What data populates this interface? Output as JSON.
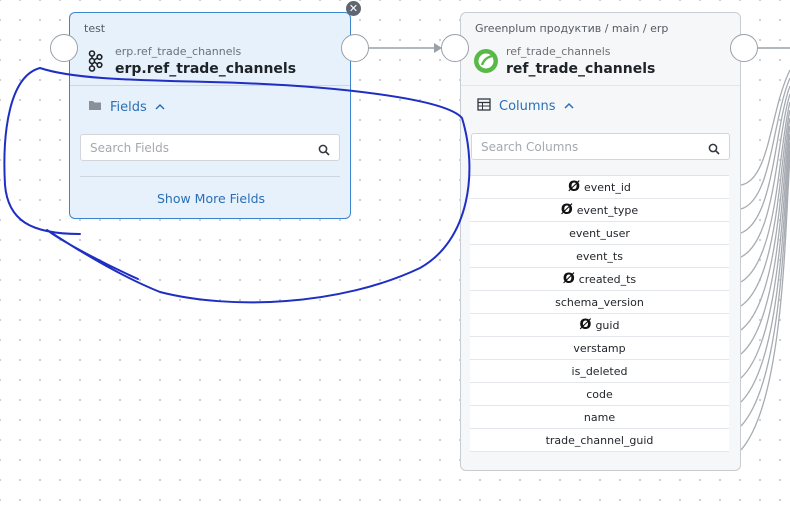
{
  "left_node": {
    "context": "test",
    "subtitle": "erp.ref_trade_channels",
    "title": "erp.ref_trade_channels",
    "fields_label": "Fields",
    "search_placeholder": "Search Fields",
    "show_more": "Show More Fields",
    "icon": "kafka-topic-icon",
    "close_icon": "close-icon"
  },
  "right_node": {
    "breadcrumb": "Greenplum продуктив / main / erp",
    "subtitle": "ref_trade_channels",
    "title": "ref_trade_channels",
    "columns_label": "Columns",
    "search_placeholder": "Search Columns",
    "icon": "greenplum-icon",
    "columns": [
      {
        "name": "event_id",
        "nullable_marker": "Ø"
      },
      {
        "name": "event_type",
        "nullable_marker": "Ø"
      },
      {
        "name": "event_user",
        "nullable_marker": ""
      },
      {
        "name": "event_ts",
        "nullable_marker": ""
      },
      {
        "name": "created_ts",
        "nullable_marker": "Ø"
      },
      {
        "name": "schema_version",
        "nullable_marker": ""
      },
      {
        "name": "guid",
        "nullable_marker": "Ø"
      },
      {
        "name": "verstamp",
        "nullable_marker": ""
      },
      {
        "name": "is_deleted",
        "nullable_marker": ""
      },
      {
        "name": "code",
        "nullable_marker": ""
      },
      {
        "name": "name",
        "nullable_marker": ""
      },
      {
        "name": "trade_channel_guid",
        "nullable_marker": ""
      }
    ]
  },
  "colors": {
    "accent": "#2a6fb5",
    "selected_node_bg": "#e6f1fb",
    "selected_node_border": "#3b86cf",
    "annotation_stroke": "#1f2fc4",
    "edge": "#9aa0a7"
  }
}
